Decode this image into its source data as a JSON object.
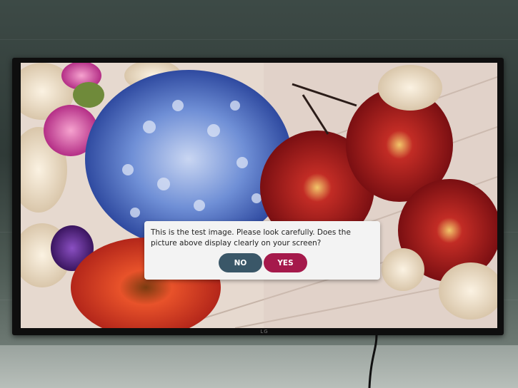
{
  "dialog": {
    "message": "This is the test image. Please look carefully. Does the picture above display clearly on your screen?",
    "no_label": "NO",
    "yes_label": "YES"
  },
  "tv": {
    "brand": "LG"
  },
  "colors": {
    "no_button": "#3a5768",
    "yes_button": "#a5194b",
    "dialog_bg": "#f3f3f3"
  }
}
